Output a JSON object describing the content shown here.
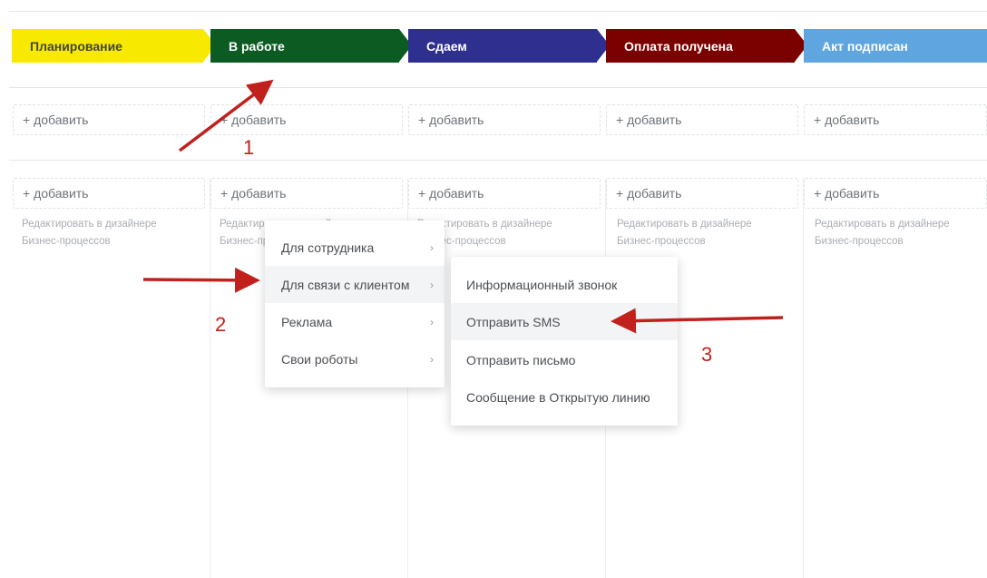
{
  "stages": [
    {
      "label": "Планирование",
      "color": "#f7ea00",
      "text_color": "#444444"
    },
    {
      "label": "В работе",
      "color": "#0b5b23",
      "text_color": "#ffffff"
    },
    {
      "label": "Сдаем",
      "color": "#2e2f8f",
      "text_color": "#ffffff"
    },
    {
      "label": "Оплата получена",
      "color": "#7b0000",
      "text_color": "#ffffff"
    },
    {
      "label": "Акт подписан",
      "color": "#5fa5df",
      "text_color": "#ffffff"
    }
  ],
  "add_label": "+ добавить",
  "hint": {
    "line1": "Редактировать в дизайнере",
    "line2": "Бизнес-процессов"
  },
  "menu": {
    "items": [
      "Для сотрудника",
      "Для связи с клиентом",
      "Реклама",
      "Свои роботы"
    ],
    "chevron": "›"
  },
  "submenu": {
    "items": [
      "Информационный звонок",
      "Отправить SMS",
      "Отправить письмо",
      "Сообщение в Открытую линию"
    ]
  },
  "annotations": {
    "step1": "1",
    "step2": "2",
    "step3": "3",
    "arrow_color": "#c0211c"
  }
}
